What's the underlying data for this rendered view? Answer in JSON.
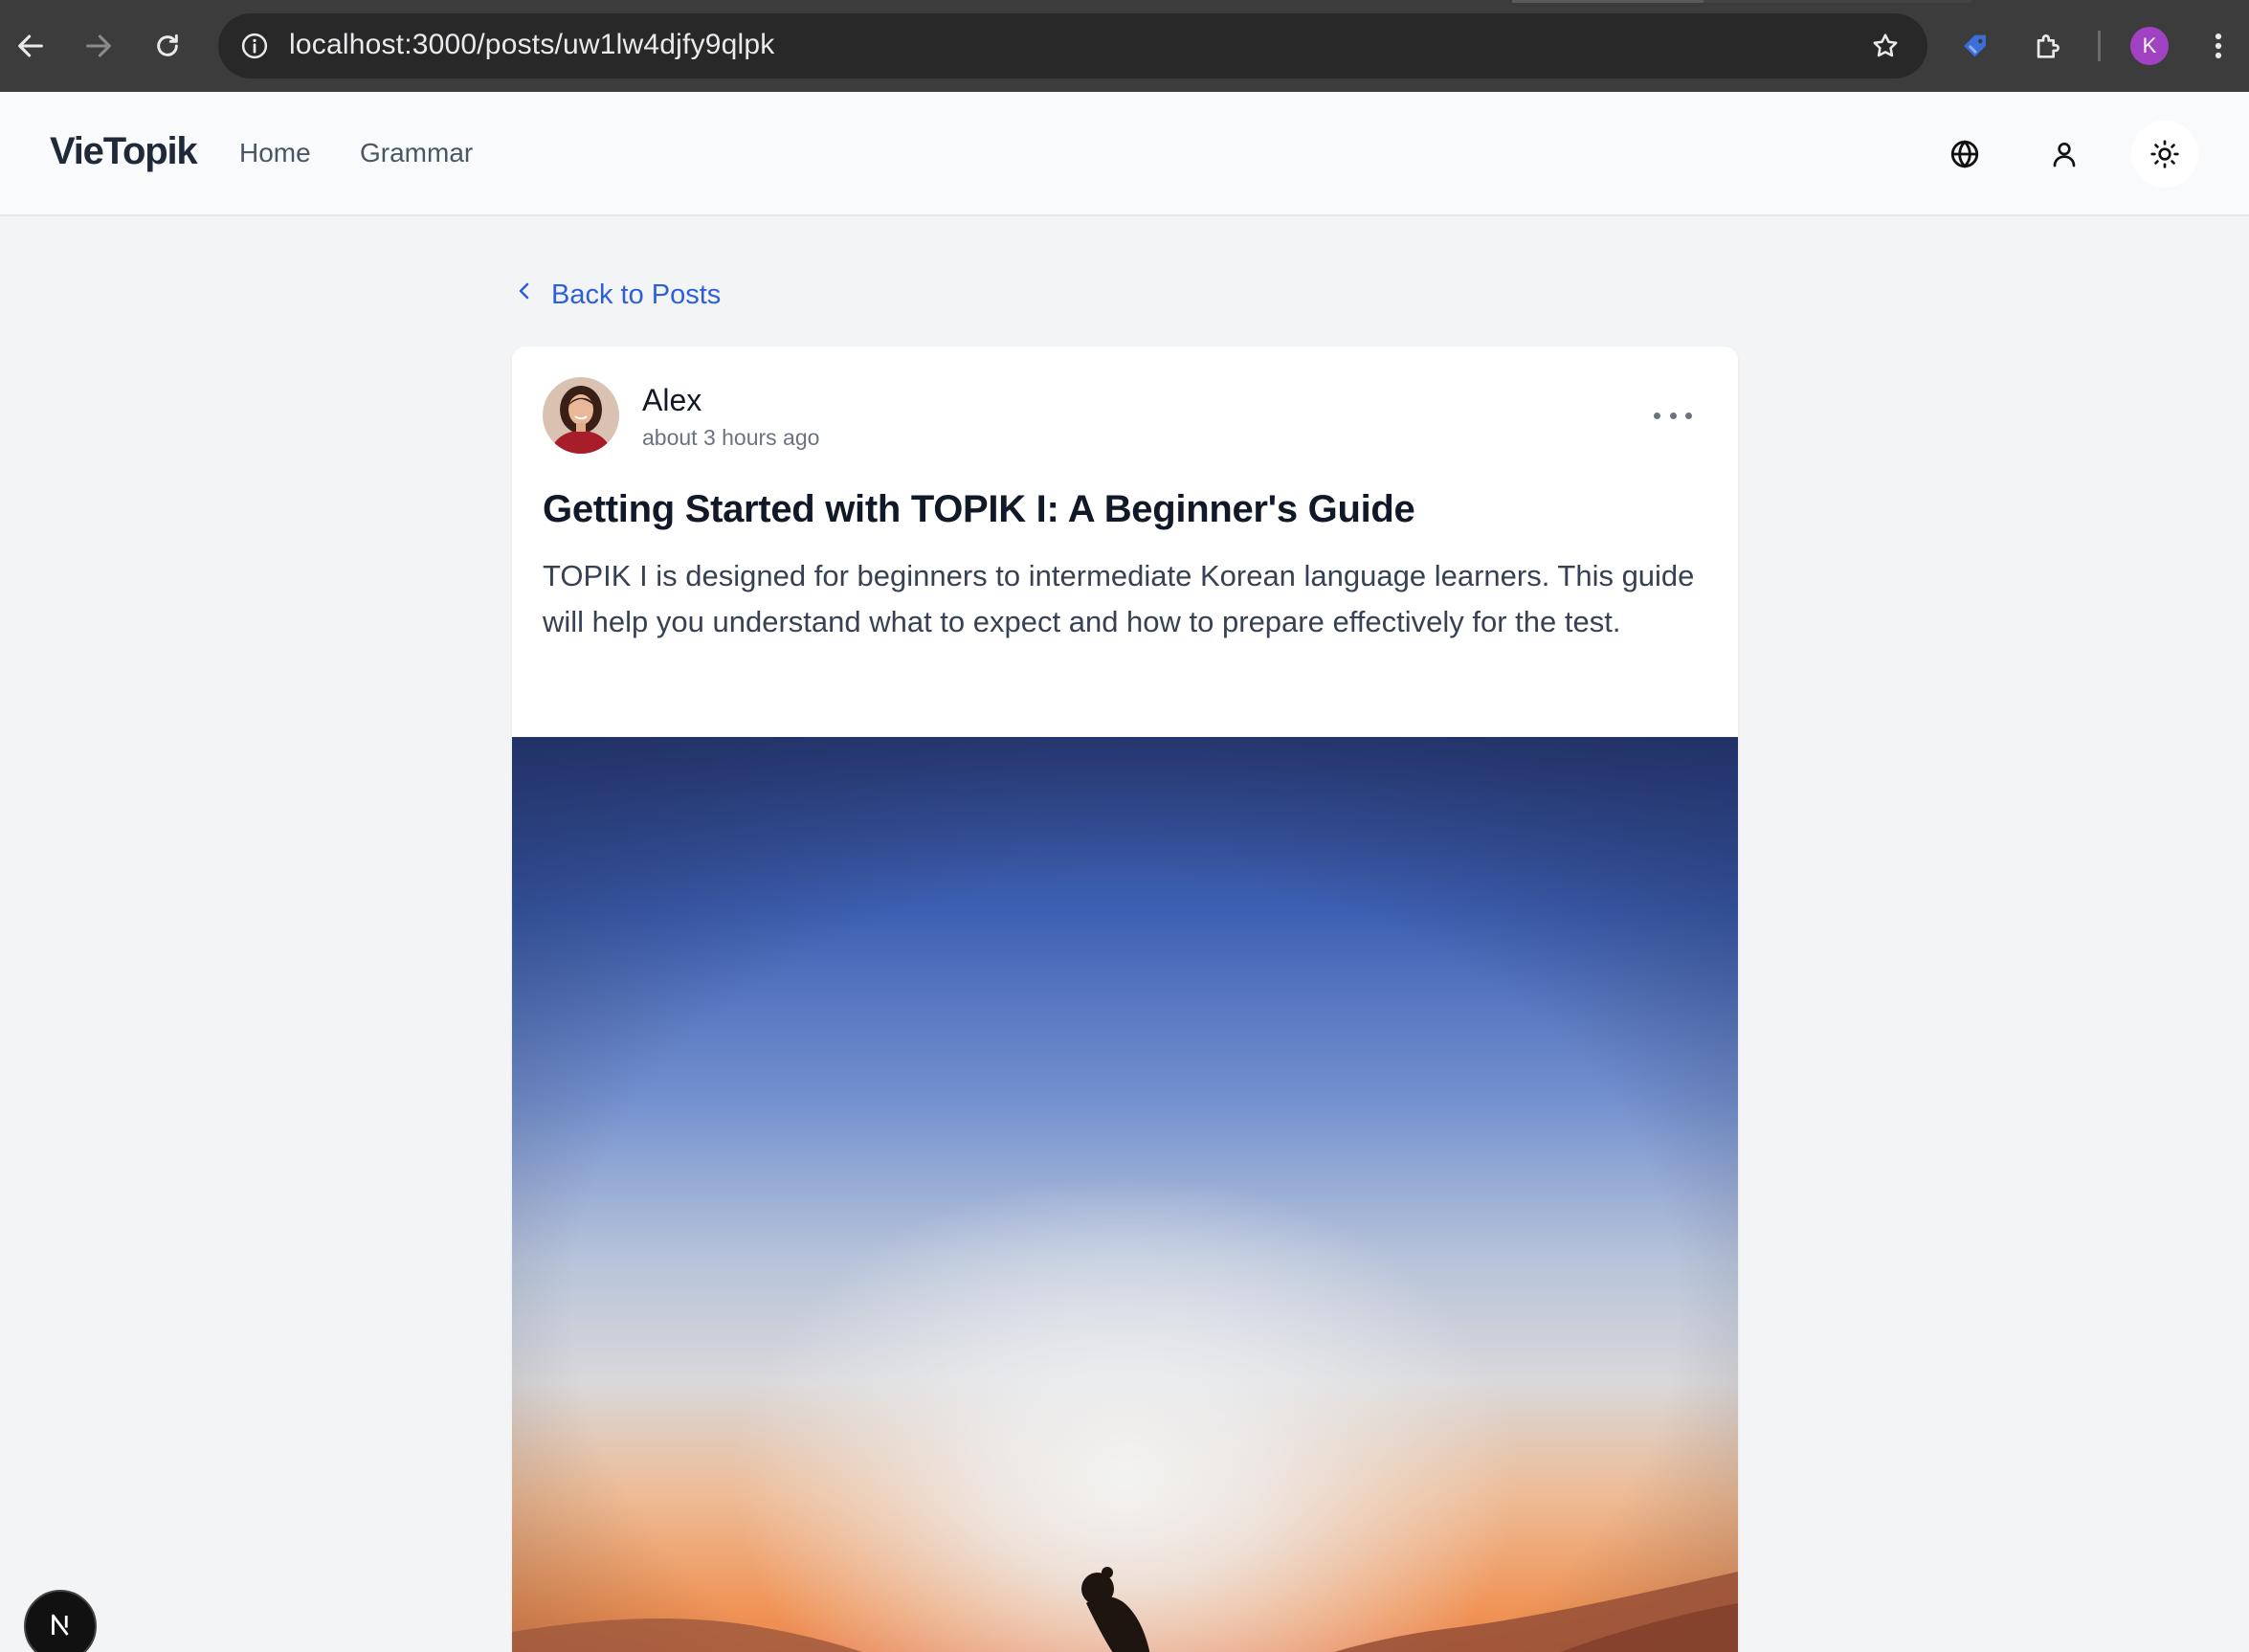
{
  "browser": {
    "url": "localhost:3000/posts/uw1lw4djfy9qlpk",
    "profile_initial": "K"
  },
  "header": {
    "logo": "VieTopik",
    "nav": [
      "Home",
      "Grammar"
    ]
  },
  "back_link": {
    "label": "Back to Posts"
  },
  "post": {
    "author": "Alex",
    "time": "about 3 hours ago",
    "title": "Getting Started with TOPIK I: A Beginner's Guide",
    "excerpt": "TOPIK I is designed for beginners to intermediate Korean language learners. This guide will help you understand what to expect and how to prepare effectively for the test."
  },
  "colors": {
    "accent": "#2f5fd8",
    "profile": "#a142c2",
    "page_bg": "#f3f4f6"
  },
  "icons": [
    "back-arrow-icon",
    "forward-arrow-icon",
    "reload-icon",
    "info-icon",
    "star-icon",
    "tag-extension-icon",
    "puzzle-extensions-icon",
    "kebab-menu-icon",
    "globe-icon",
    "user-icon",
    "sun-icon",
    "chevron-left-icon",
    "more-horizontal-icon",
    "nextjs-icon"
  ]
}
